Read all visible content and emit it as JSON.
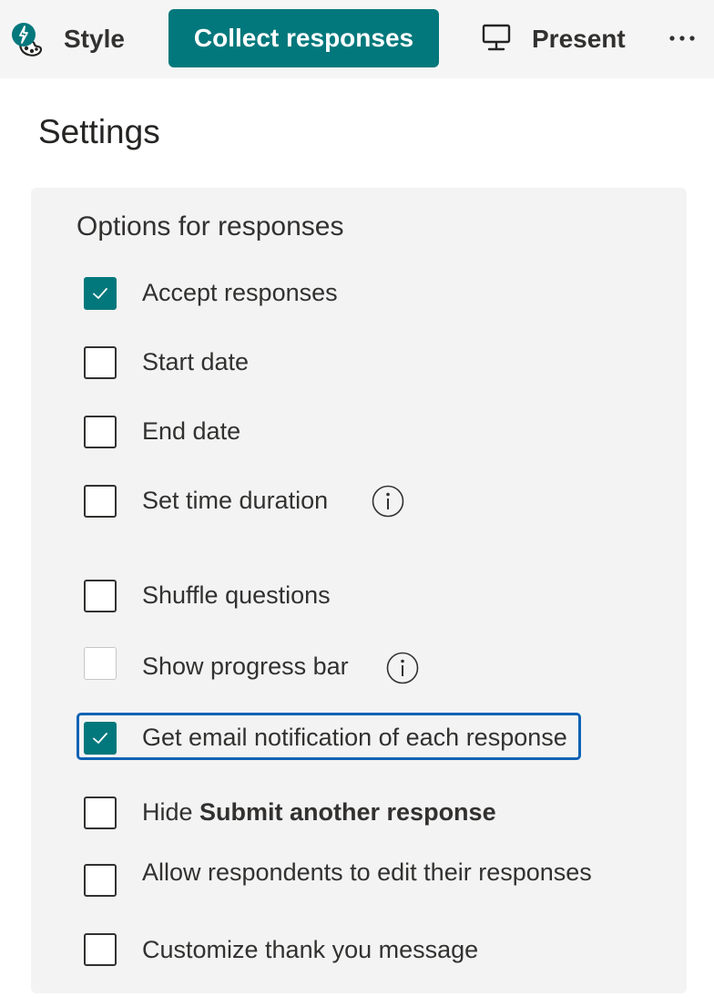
{
  "toolbar": {
    "style_label": "Style",
    "collect_label": "Collect responses",
    "present_label": "Present",
    "more_label": "···"
  },
  "settings": {
    "title": "Settings",
    "section_heading": "Options for responses",
    "options": [
      {
        "label": "Accept responses",
        "checked": true
      },
      {
        "label": "Start date",
        "checked": false
      },
      {
        "label": "End date",
        "checked": false
      },
      {
        "label": "Set time duration",
        "checked": false,
        "info": true
      },
      {
        "label": "Shuffle questions",
        "checked": false
      },
      {
        "label": "Show progress bar",
        "checked": false,
        "disabled": true,
        "info": true
      },
      {
        "label": "Get email notification of each response",
        "checked": true,
        "focused": true
      },
      {
        "label_prefix": "Hide ",
        "label_bold": "Submit another response",
        "checked": false
      },
      {
        "label": "Allow respondents to edit their responses",
        "checked": false
      },
      {
        "label": "Customize thank you message",
        "checked": false
      }
    ]
  },
  "colors": {
    "accent": "#03787c",
    "focus": "#0f62b5",
    "panel_bg": "#f3f3f3",
    "toolbar_bg": "#f5f5f5"
  },
  "icons": {
    "style": "palette-lightning-icon",
    "present": "monitor-icon",
    "more": "ellipsis-icon",
    "info": "info-circle-icon",
    "check": "checkmark-icon"
  }
}
